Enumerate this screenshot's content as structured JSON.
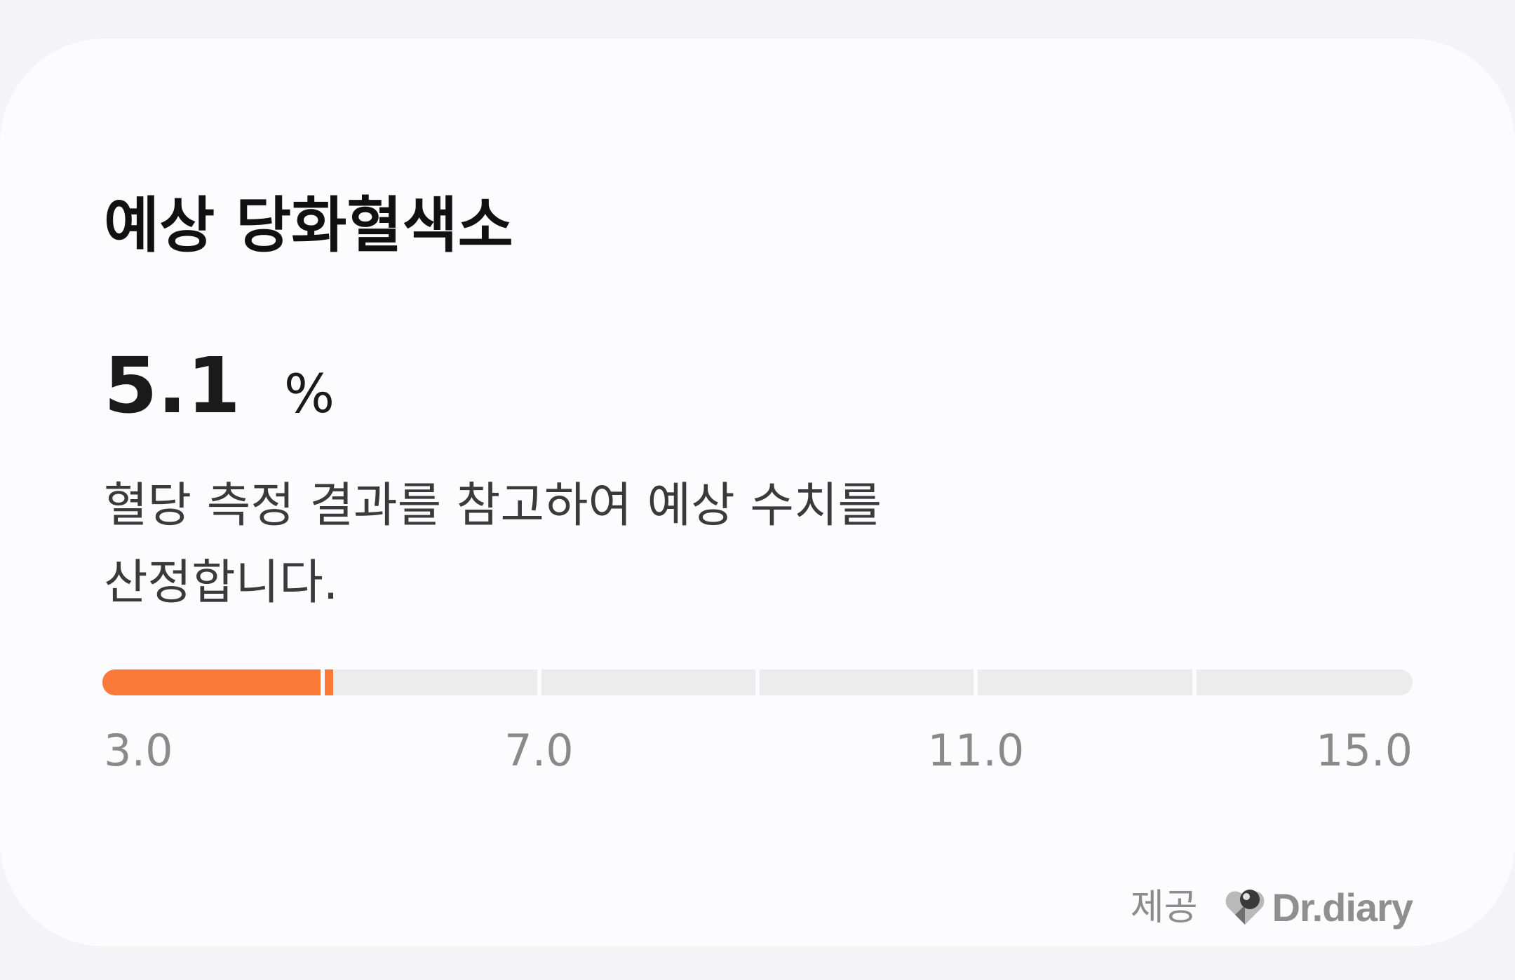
{
  "card": {
    "title": "예상 당화혈색소",
    "value": "5.1",
    "unit": "%",
    "description_line1": "혈당 측정 결과를 참고하여 예상 수치를",
    "description_line2": "산정합니다."
  },
  "gauge": {
    "min": 3.0,
    "max": 15.0,
    "current": 5.1,
    "accent_color": "#fb7a3a",
    "track_color": "#ececec",
    "segment_boundaries": [
      7.0,
      9.0,
      11.0,
      13.0
    ],
    "tick_labels": [
      "3.0",
      "7.0",
      "11.0",
      "15.0"
    ]
  },
  "footer": {
    "provided_label": "제공",
    "brand_name": "Dr.diary",
    "brand_icon": "dr-diary-logo-icon"
  }
}
